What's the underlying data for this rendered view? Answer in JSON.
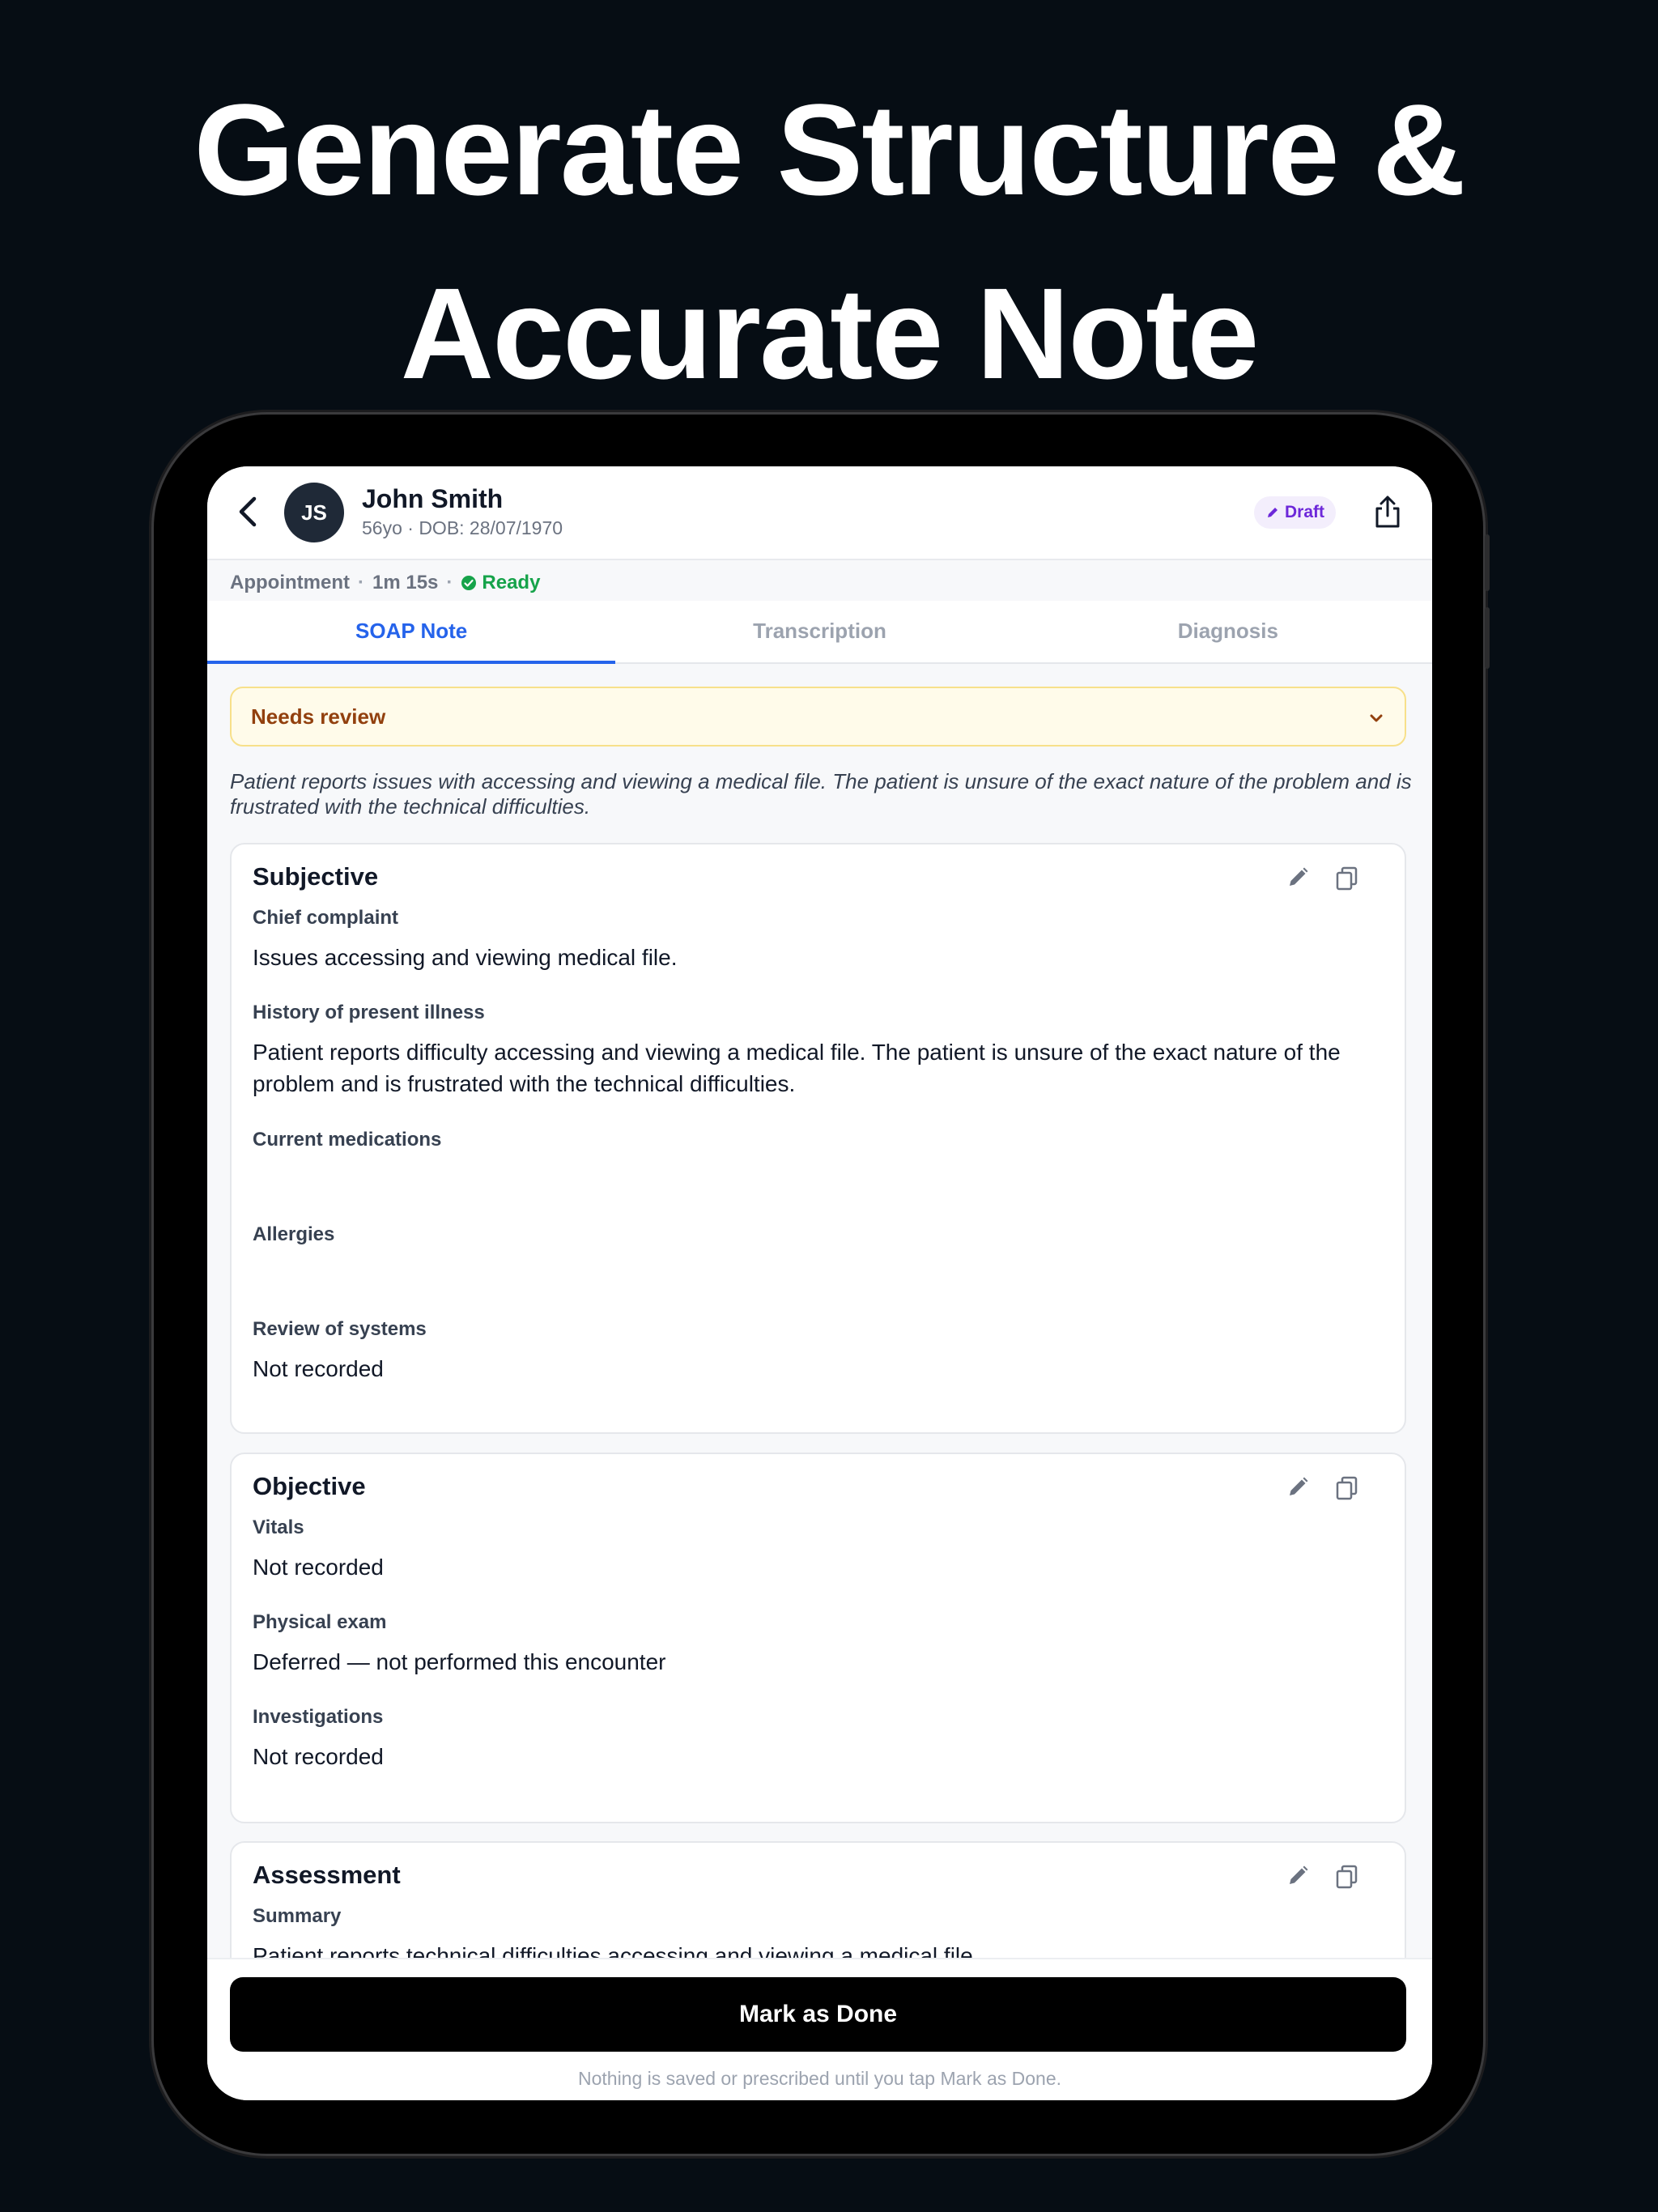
{
  "headline": {
    "line1": "Generate Structure &",
    "line2": "Accurate Note"
  },
  "patient": {
    "initials": "JS",
    "name": "John Smith",
    "meta": "56yo · DOB: 28/07/1970"
  },
  "status_badge": "Draft",
  "appointment": {
    "label": "Appointment",
    "duration": "1m 15s",
    "status": "Ready"
  },
  "tabs": [
    {
      "label": "SOAP Note",
      "active": true
    },
    {
      "label": "Transcription",
      "active": false
    },
    {
      "label": "Diagnosis",
      "active": false
    }
  ],
  "review": {
    "label": "Needs review"
  },
  "summary": "Patient reports issues with accessing and viewing a medical file. The patient is unsure of the exact nature of the problem and is frustrated with the technical difficulties.",
  "sections": {
    "subjective": {
      "title": "Subjective",
      "fields": [
        {
          "label": "Chief complaint",
          "value": "Issues accessing and viewing medical file."
        },
        {
          "label": "History of present illness",
          "value": "Patient reports difficulty accessing and viewing a medical file. The patient is unsure of the exact nature of the problem and is frustrated with the technical difficulties."
        },
        {
          "label": "Current medications",
          "value": ""
        },
        {
          "label": "Allergies",
          "value": ""
        },
        {
          "label": "Review of systems",
          "value": "Not recorded"
        }
      ]
    },
    "objective": {
      "title": "Objective",
      "fields": [
        {
          "label": "Vitals",
          "value": "Not recorded"
        },
        {
          "label": "Physical exam",
          "value": "Deferred — not performed this encounter"
        },
        {
          "label": "Investigations",
          "value": "Not recorded"
        }
      ]
    },
    "assessment": {
      "title": "Assessment",
      "fields": [
        {
          "label": "Summary",
          "value": "Patient reports technical difficulties accessing and viewing a medical file."
        }
      ]
    }
  },
  "footer": {
    "button_label": "Mark as Done",
    "note": "Nothing is saved or prescribed until you tap Mark as Done."
  },
  "colors": {
    "accent": "#2563eb",
    "ready": "#16a34a",
    "draft": "#6d28d9",
    "review_bg": "#fffbea"
  }
}
